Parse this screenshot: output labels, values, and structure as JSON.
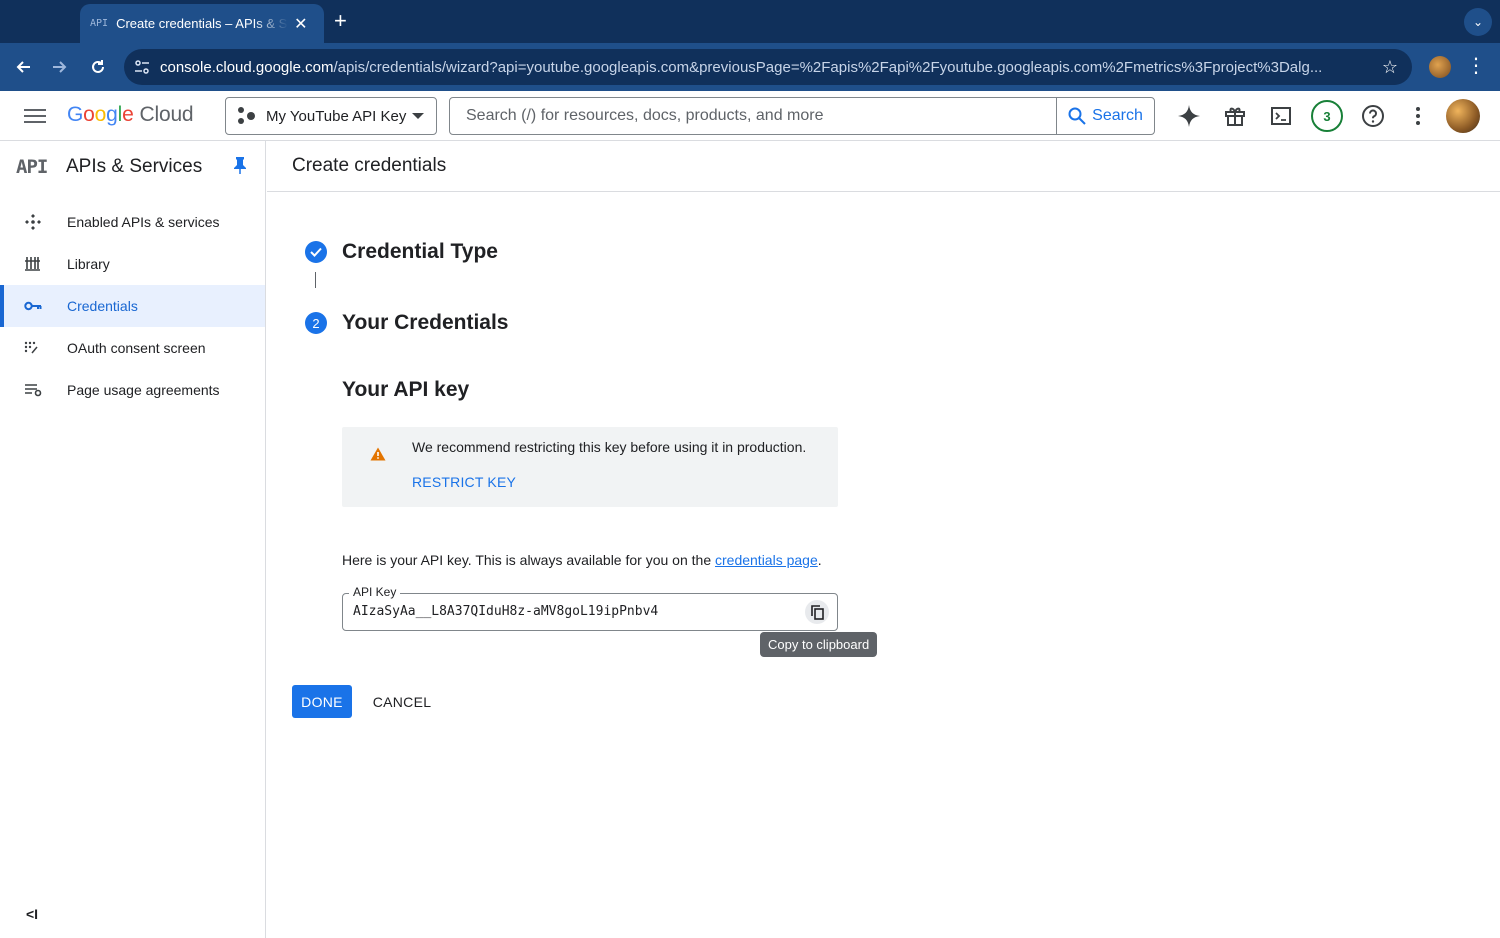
{
  "browser": {
    "tab_title": "Create credentials – APIs & Services",
    "tab_favicon": "API",
    "url_host": "console.cloud.google.com",
    "url_path": "/apis/credentials/wizard?api=youtube.googleapis.com&previousPage=%2Fapis%2Fapi%2Fyoutube.googleapis.com%2Fmetrics%3Fproject%3Dalg..."
  },
  "header": {
    "logo_google": [
      "G",
      "o",
      "o",
      "g",
      "l",
      "e"
    ],
    "logo_cloud": "Cloud",
    "project_name": "My YouTube API Key",
    "search_placeholder": "Search (/) for resources, docs, products, and more",
    "search_button": "Search",
    "notification_count": "3"
  },
  "sidebar": {
    "badge": "API",
    "title": "APIs & Services",
    "items": [
      {
        "label": "Enabled APIs & services",
        "icon": "apps-icon"
      },
      {
        "label": "Library",
        "icon": "library-icon"
      },
      {
        "label": "Credentials",
        "icon": "key-icon",
        "active": true
      },
      {
        "label": "OAuth consent screen",
        "icon": "consent-icon"
      },
      {
        "label": "Page usage agreements",
        "icon": "agreements-icon"
      }
    ],
    "collapse": "<I"
  },
  "main": {
    "page_title": "Create credentials",
    "steps": [
      {
        "title": "Credential Type",
        "status": "complete"
      },
      {
        "number": "2",
        "title": "Your Credentials",
        "status": "current"
      }
    ],
    "api_key_heading": "Your API key",
    "warning_text": "We recommend restricting this key before using it in production.",
    "restrict_link": "RESTRICT KEY",
    "info_text": "Here is your API key. This is always available for you on the",
    "info_link": "credentials page",
    "info_suffix": ".",
    "key_label": "API Key",
    "key_value": "AIzaSyAa__L8A37QIduH8z-aMV8goL19ipPnbv4",
    "copy_tooltip": "Copy to clipboard",
    "done_button": "DONE",
    "cancel_button": "CANCEL"
  },
  "colors": {
    "chrome_dark": "#10305b",
    "chrome_toolbar": "#1f4f8a",
    "accent": "#1a73e8",
    "warning": "#e37400"
  }
}
